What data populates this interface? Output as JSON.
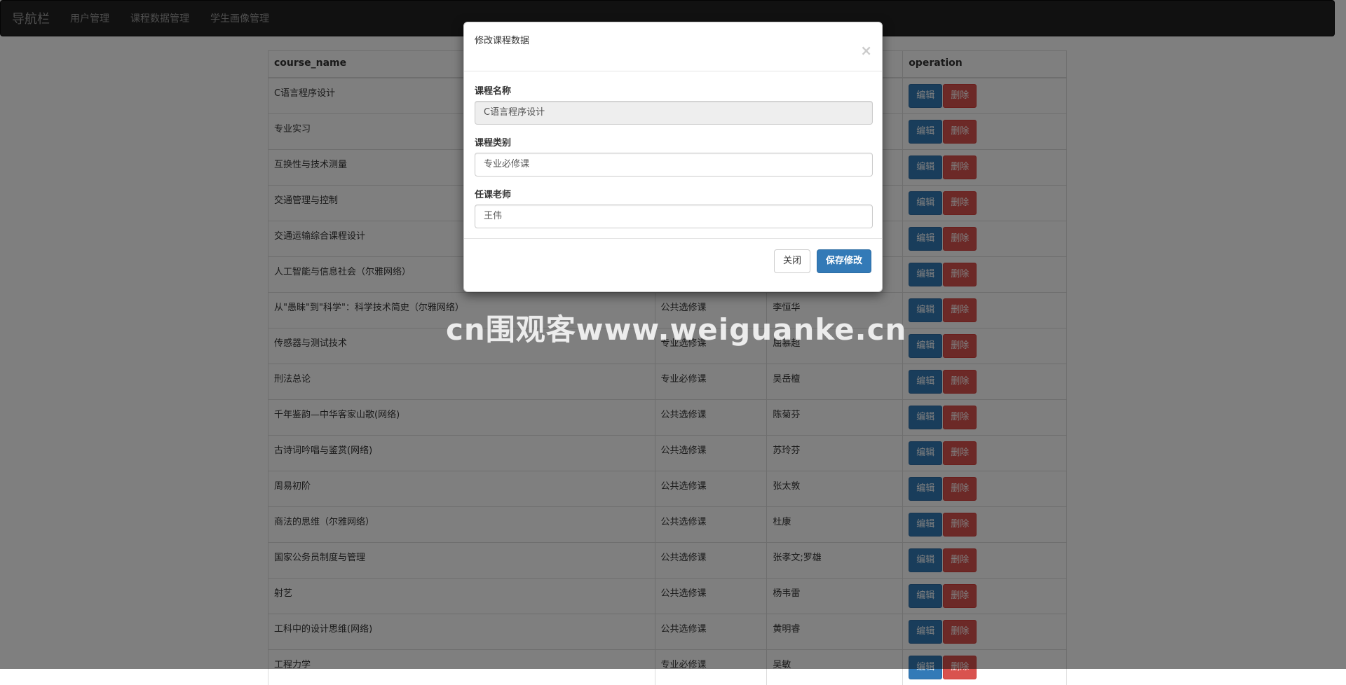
{
  "navbar": {
    "brand": "导航栏",
    "links": [
      "用户管理",
      "课程数据管理",
      "学生画像管理"
    ]
  },
  "table": {
    "headers": [
      "course_name",
      "",
      "",
      "operation"
    ],
    "rows": [
      {
        "name": "C语言程序设计",
        "type": "",
        "teacher": ""
      },
      {
        "name": "专业实习",
        "type": "",
        "teacher": ""
      },
      {
        "name": "互换性与技术测量",
        "type": "",
        "teacher": ""
      },
      {
        "name": "交通管理与控制",
        "type": "",
        "teacher": ""
      },
      {
        "name": "交通运输综合课程设计",
        "type": "",
        "teacher": ""
      },
      {
        "name": "人工智能与信息社会（尔雅网络）",
        "type": "",
        "teacher": ""
      },
      {
        "name": "从\"愚昧\"到\"科学\"：科学技术简史（尔雅网络）",
        "type": "公共选修课",
        "teacher": "李恒华"
      },
      {
        "name": "传感器与测试技术",
        "type": "专业选修课",
        "teacher": "屈慕超"
      },
      {
        "name": "刑法总论",
        "type": "专业必修课",
        "teacher": "吴岳檀"
      },
      {
        "name": "千年鉴韵—中华客家山歌(网络)",
        "type": "公共选修课",
        "teacher": "陈菊芬"
      },
      {
        "name": "古诗词吟唱与鉴赏(网络)",
        "type": "公共选修课",
        "teacher": "苏玲芬"
      },
      {
        "name": "周易初阶",
        "type": "公共选修课",
        "teacher": "张太敦"
      },
      {
        "name": "商法的思维（尔雅网络）",
        "type": "公共选修课",
        "teacher": "杜康"
      },
      {
        "name": "国家公务员制度与管理",
        "type": "公共选修课",
        "teacher": "张孝文;罗雄"
      },
      {
        "name": "射艺",
        "type": "公共选修课",
        "teacher": "杨韦雷"
      },
      {
        "name": "工科中的设计思维(网络)",
        "type": "公共选修课",
        "teacher": "黄明睿"
      },
      {
        "name": "工程力学",
        "type": "专业必修课",
        "teacher": "吴敏"
      }
    ],
    "edit_label": "编辑",
    "delete_label": "删除"
  },
  "modal": {
    "title": "修改课程数据",
    "close_glyph": "×",
    "fields": {
      "course_name_label": "课程名称",
      "course_name_value": "C语言程序设计",
      "course_type_label": "课程类别",
      "course_type_value": "专业必修课",
      "teacher_label": "任课老师",
      "teacher_value": "王伟"
    },
    "close_button": "关闭",
    "save_button": "保存修改"
  },
  "watermark": "cn围观客www.weiguanke.cn",
  "colors": {
    "primary": "#337ab7",
    "danger": "#d9534f",
    "navbar": "#222222"
  }
}
